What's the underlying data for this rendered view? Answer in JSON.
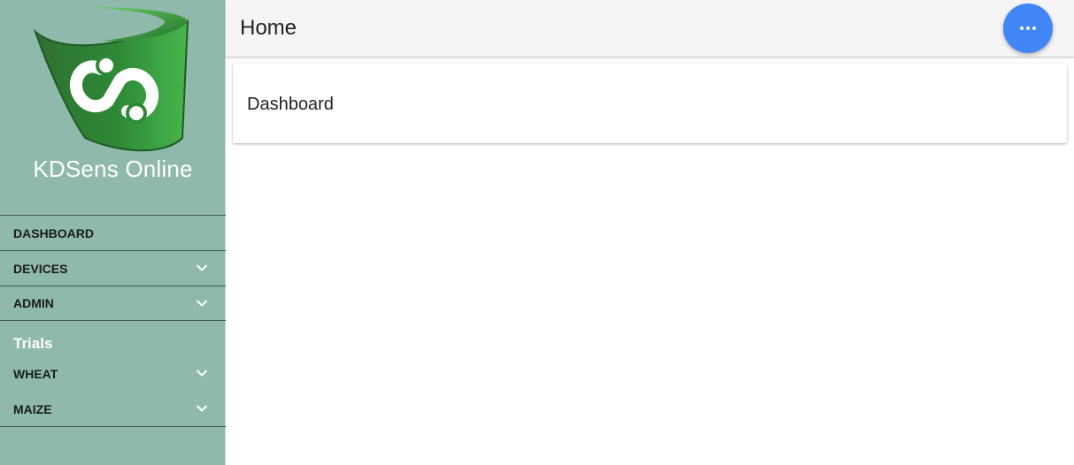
{
  "brand": {
    "name": "KDSens Online"
  },
  "sidebar": {
    "items": [
      {
        "label": "DASHBOARD",
        "has_chevron": false
      },
      {
        "label": "DEVICES",
        "has_chevron": true
      },
      {
        "label": "ADMIN",
        "has_chevron": true
      }
    ],
    "section": {
      "heading": "Trials",
      "items": [
        {
          "label": "WHEAT",
          "has_chevron": true
        },
        {
          "label": "MAIZE",
          "has_chevron": true
        }
      ]
    }
  },
  "header": {
    "title": "Home",
    "more_button_icon": "ellipsis-icon"
  },
  "main": {
    "card_title": "Dashboard"
  },
  "colors": {
    "sidebar_bg": "#8fb9ab",
    "header_bg": "#f5f5f5",
    "fab_bg": "#4285f4",
    "logo_green": "#2e8b3a"
  }
}
